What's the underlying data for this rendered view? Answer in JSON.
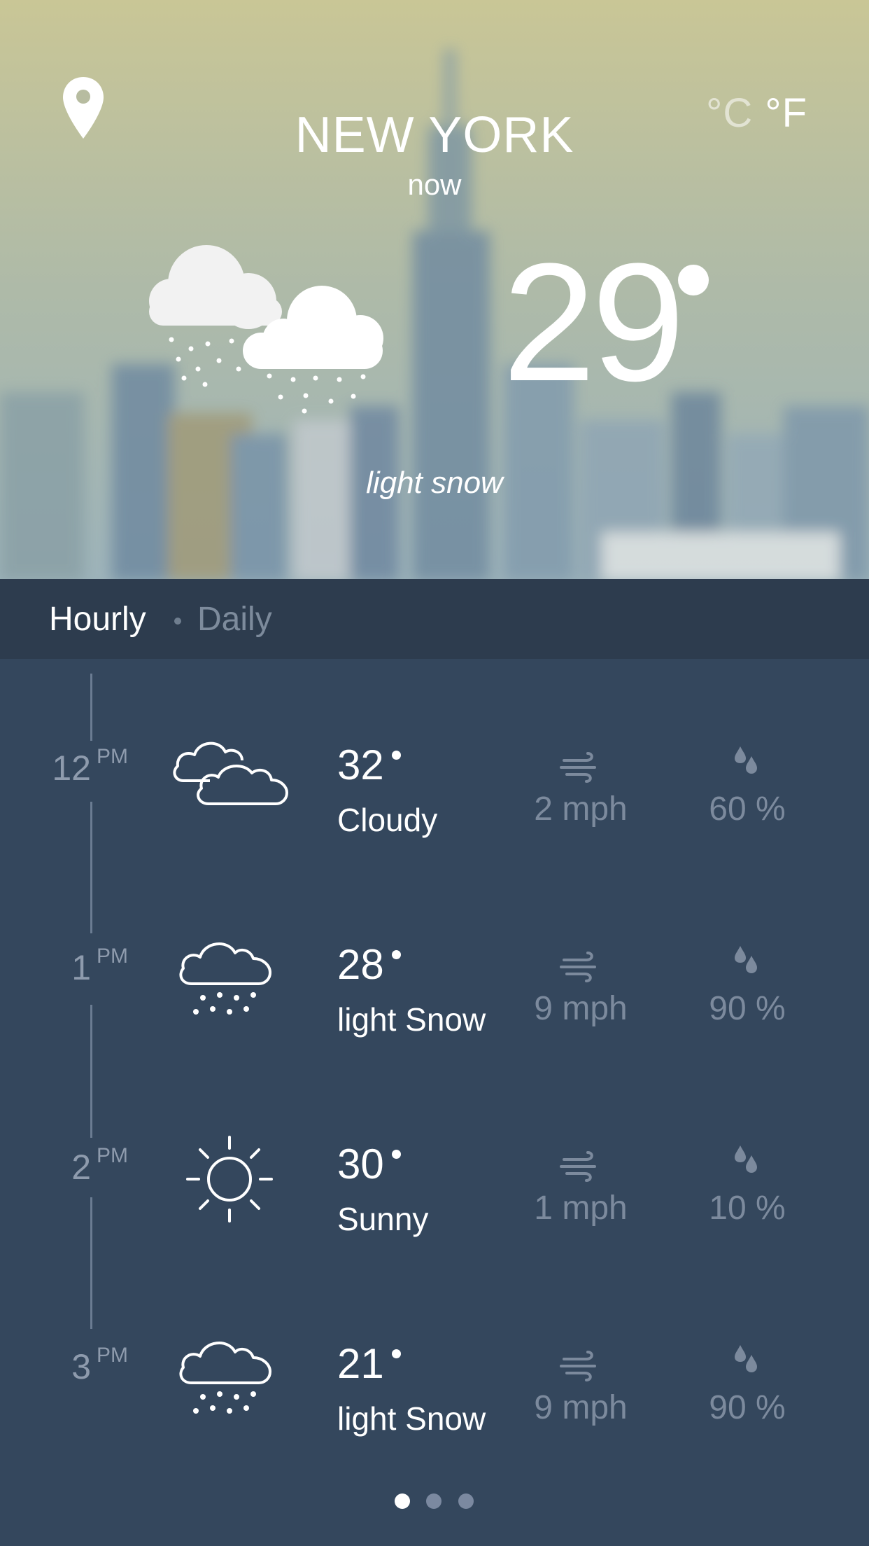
{
  "header": {
    "city": "NEW YORK",
    "when": "now",
    "unit_c": "°C",
    "unit_f": "°F",
    "active_unit": "F",
    "location_icon": "map-pin-icon"
  },
  "current": {
    "temperature": "29",
    "condition": "light snow",
    "icon": "light-snow-cloud-icon"
  },
  "tabs": {
    "hourly": "Hourly",
    "daily": "Daily",
    "active": "hourly"
  },
  "hourly": [
    {
      "hour": "12",
      "ampm": "PM",
      "temp": "32",
      "desc": "Cloudy",
      "icon": "cloudy-icon",
      "wind": "2",
      "wind_unit": "mph",
      "humidity": "60",
      "humidity_unit": "%"
    },
    {
      "hour": "1",
      "ampm": "PM",
      "temp": "28",
      "desc": "light Snow",
      "icon": "light-snow-icon",
      "wind": "9",
      "wind_unit": "mph",
      "humidity": "90",
      "humidity_unit": "%"
    },
    {
      "hour": "2",
      "ampm": "PM",
      "temp": "30",
      "desc": "Sunny",
      "icon": "sunny-icon",
      "wind": "1",
      "wind_unit": "mph",
      "humidity": "10",
      "humidity_unit": "%"
    },
    {
      "hour": "3",
      "ampm": "PM",
      "temp": "21",
      "desc": "light Snow",
      "icon": "light-snow-icon",
      "wind": "9",
      "wind_unit": "mph",
      "humidity": "90",
      "humidity_unit": "%"
    }
  ],
  "pager": {
    "pages": 3,
    "active": 0
  },
  "colors": {
    "panel": "#34475d",
    "tabbar": "#2d3c4e",
    "muted": "#7c8a9d"
  }
}
